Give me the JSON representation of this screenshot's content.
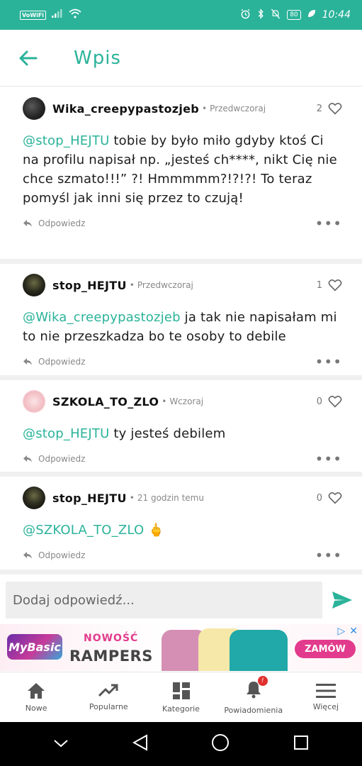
{
  "status_bar": {
    "wifi_label": "VoWiFi",
    "battery": "80",
    "time": "10:44"
  },
  "header": {
    "title": "Wpis"
  },
  "comments": [
    {
      "author": "Wika_creepypastozjeb",
      "time": "Przedwczoraj",
      "likes": "2",
      "mention": "@stop_HEJTU",
      "text": " tobie by było miło gdyby ktoś Ci na profilu napisał np. „jesteś ch****, nikt Cię nie chce szmato!!!” ?! Hmmmmm?!?!?! To teraz pomyśl jak inni się przez to czują!",
      "reply_label": "Odpowiedz"
    },
    {
      "author": "stop_HEJTU",
      "time": "Przedwczoraj",
      "likes": "1",
      "mention": "@Wika_creepypastozjeb",
      "text": " ja tak nie napisałam mi to nie przeszkadza bo te osoby to debile",
      "reply_label": "Odpowiedz"
    },
    {
      "author": "SZKOLA_TO_ZLO",
      "time": "Wczoraj",
      "likes": "0",
      "mention": "@stop_HEJTU",
      "text": " ty jesteś debilem",
      "reply_label": "Odpowiedz"
    },
    {
      "author": "stop_HEJTU",
      "time": "21 godzin temu",
      "likes": "0",
      "mention": "@SZKOLA_TO_ZLO",
      "text": " 🖕",
      "reply_label": "Odpowiedz"
    }
  ],
  "reply_bar": {
    "placeholder": "Dodaj odpowiedź..."
  },
  "ad": {
    "brand": "MyBasic",
    "new_label": "NOWOŚĆ",
    "product": "RAMPERS",
    "cta": "ZAMÓW"
  },
  "bottom_nav": [
    {
      "label": "Nowe",
      "icon": "home-icon"
    },
    {
      "label": "Popularne",
      "icon": "trending-icon"
    },
    {
      "label": "Kategorie",
      "icon": "grid-icon"
    },
    {
      "label": "Powiadomienia",
      "icon": "bell-icon",
      "badge": "!"
    },
    {
      "label": "Więcej",
      "icon": "menu-icon"
    }
  ],
  "colors": {
    "accent": "#2bb39a",
    "status_bar": "#2bb39a",
    "ad_pink": "#e23b8d"
  }
}
